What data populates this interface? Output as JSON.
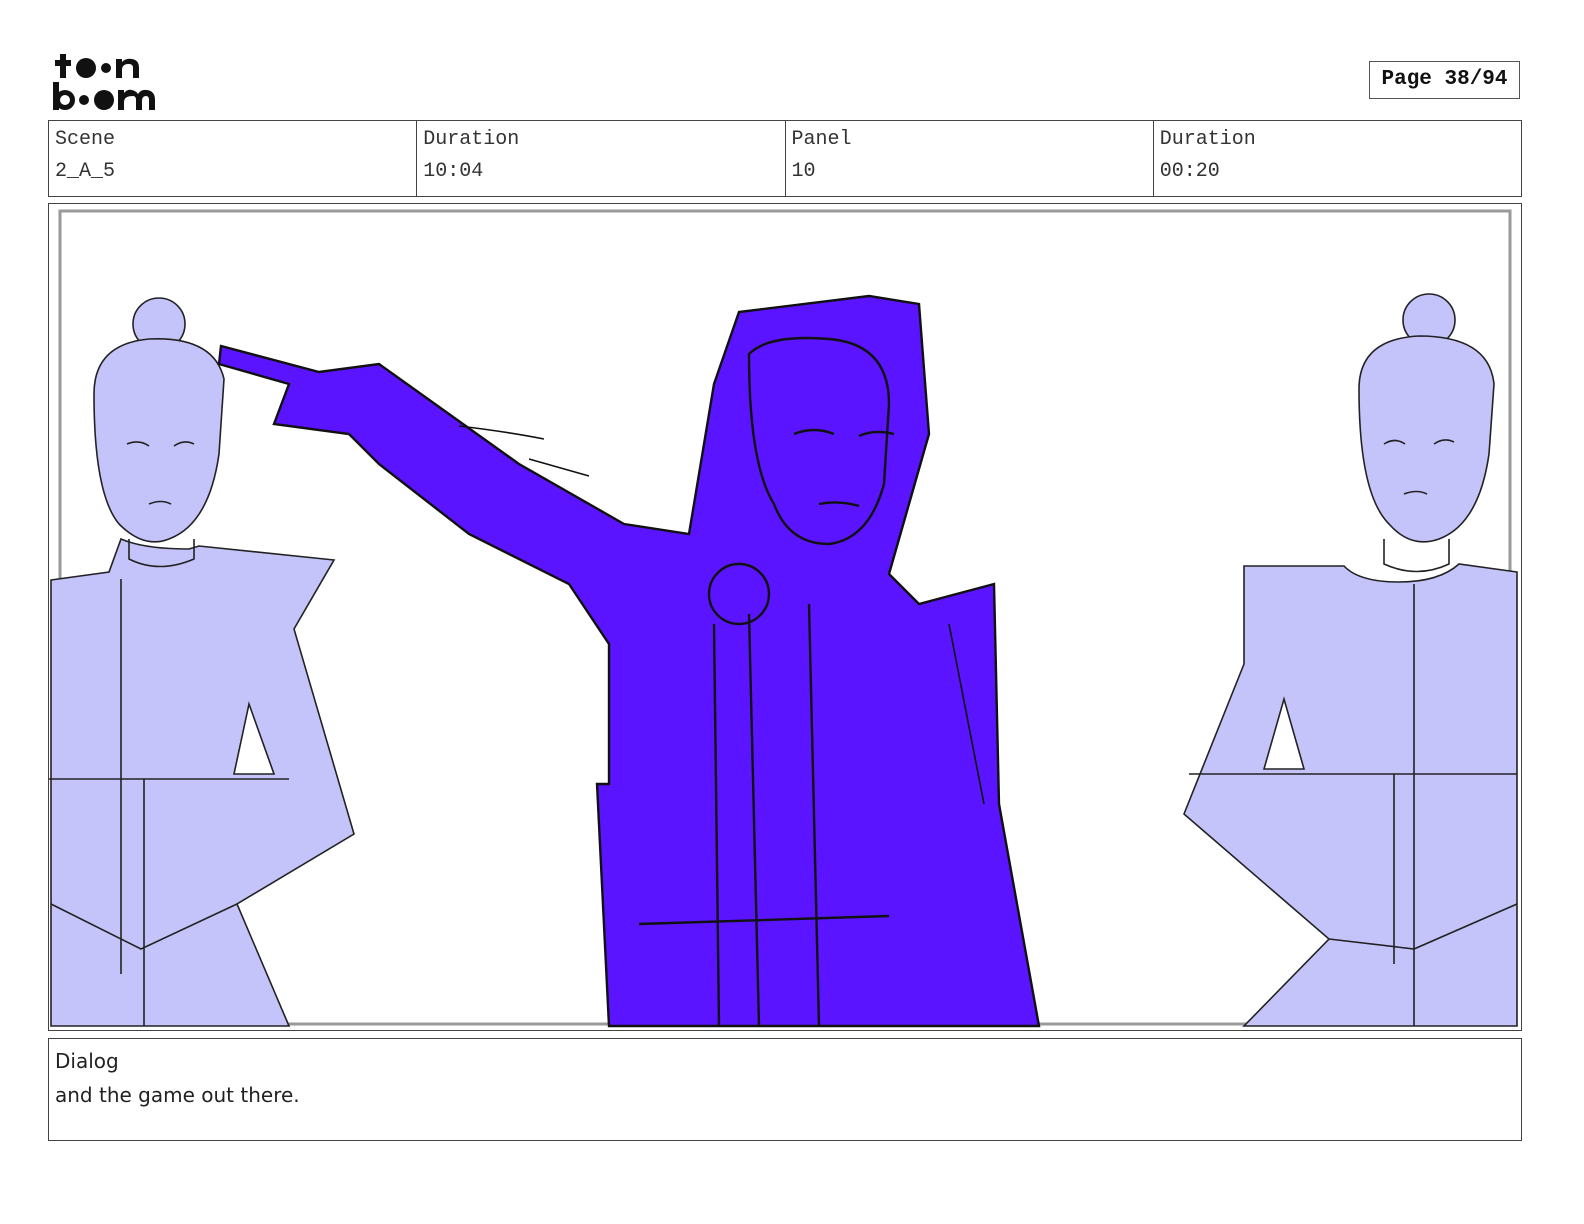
{
  "header": {
    "logo_top": "to•n",
    "logo_bottom": "b••m",
    "page_label": "Page 38/94"
  },
  "info": {
    "scene_label": "Scene",
    "scene_value": "2_A_5",
    "duration_label": "Duration",
    "duration_value": "10:04",
    "panel_label": "Panel",
    "panel_value": "10",
    "panel_duration_label": "Duration",
    "panel_duration_value": "00:20"
  },
  "dialog": {
    "label": "Dialog",
    "text": "and the game out there."
  },
  "colors": {
    "main_figure": "#5a14ff",
    "side_figures": "#c4c4fb",
    "line": "#111111",
    "safe_frame": "#9a9a9a"
  }
}
